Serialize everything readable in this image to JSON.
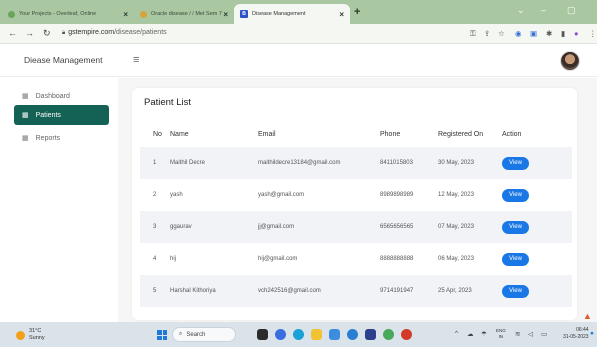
{
  "browser": {
    "tabs": [
      {
        "title": "Your Projects - Overleaf, Online",
        "active": false
      },
      {
        "title": "Oracle disease / / Met Sem 7",
        "active": false
      },
      {
        "title": "Disease Management",
        "active": true
      }
    ],
    "url_domain": "gstempire.com",
    "url_path": "/disease/patients",
    "new_tab_label": "+"
  },
  "app": {
    "brand": "Diease Management"
  },
  "sidebar": {
    "items": [
      {
        "label": "Dashboard",
        "icon": "grid-icon",
        "active": false
      },
      {
        "label": "Patients",
        "icon": "grid-icon",
        "active": true
      },
      {
        "label": "Reports",
        "icon": "grid-icon",
        "active": false
      }
    ]
  },
  "patients": {
    "title": "Patient List",
    "columns": [
      "No",
      "Name",
      "Email",
      "Phone",
      "Registered On",
      "Action"
    ],
    "rows": [
      {
        "no": "1",
        "name": "Maithil Decre",
        "email": "maithildecre13184@gmail.com",
        "phone": "8411015803",
        "registered": "30 May, 2023",
        "action": "View"
      },
      {
        "no": "2",
        "name": "yash",
        "email": "yash@gmail.com",
        "phone": "8989898989",
        "registered": "12 May, 2023",
        "action": "View"
      },
      {
        "no": "3",
        "name": "ggaurav",
        "email": "jj@gmail.com",
        "phone": "6565656565",
        "registered": "07 May, 2023",
        "action": "View"
      },
      {
        "no": "4",
        "name": "hij",
        "email": "hij@gmail.com",
        "phone": "8888888888",
        "registered": "06 May, 2023",
        "action": "View"
      },
      {
        "no": "5",
        "name": "Harshal Kithoriya",
        "email": "vch242516@gmail.com",
        "phone": "9714191947",
        "registered": "25 Apr, 2023",
        "action": "View"
      }
    ]
  },
  "taskbar": {
    "temperature": "31°C",
    "weather": "Sunny",
    "search_placeholder": "Search",
    "language": "ENG",
    "language_region": "IN",
    "time": "06:44",
    "date": "31-05-2023"
  },
  "colors": {
    "sidebar_active": "#146155",
    "view_button": "#1a78e6",
    "tab_strip": "#a9c7a1"
  }
}
